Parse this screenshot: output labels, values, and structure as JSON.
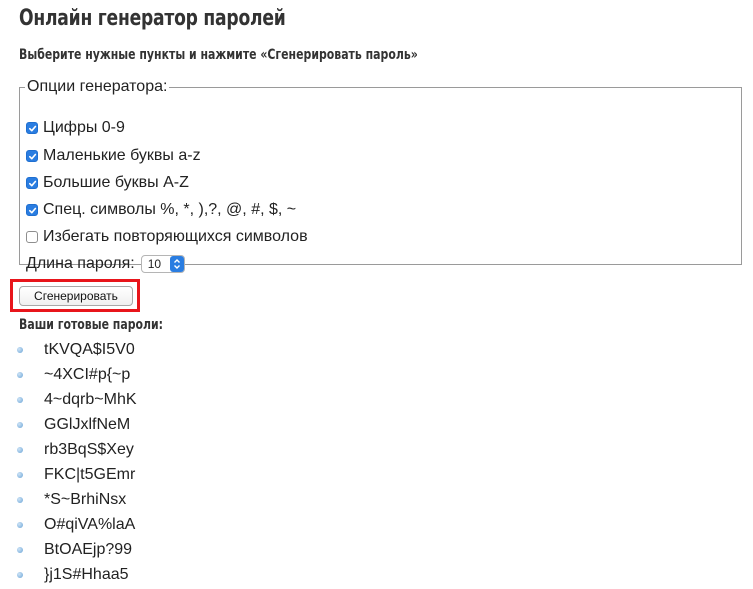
{
  "page": {
    "title": "Онлайн генератор паролей",
    "instruction": "Выберите нужные пункты и нажмите «Сгенерировать пароль»"
  },
  "options": {
    "legend": "Опции генератора:",
    "items": [
      {
        "label": "Цифры 0-9",
        "checked": true
      },
      {
        "label": "Маленькие буквы a-z",
        "checked": true
      },
      {
        "label": "Большие буквы A-Z",
        "checked": true
      },
      {
        "label": "Спец. символы %, *, ),?, @, #, $, ~",
        "checked": true
      },
      {
        "label": "Избегать повторяющихся символов",
        "checked": false
      }
    ],
    "length_label": "Длина пароля:",
    "length_value": "10"
  },
  "generate_button": {
    "label": "Сгенерировать"
  },
  "results": {
    "title": "Ваши готовые пароли:",
    "passwords": [
      "tKVQA$I5V0",
      "~4XCI#p{~p",
      "4~dqrb~MhK",
      "GGlJxlfNeM",
      "rb3BqS$Xey",
      "FKC|t5GEmr",
      "*S~BrhiNsx",
      "O#qiVA%laA",
      "BtOAEjp?99",
      "}j1S#Hhaa5"
    ]
  },
  "colors": {
    "checkbox_accent": "#2a7de1",
    "highlight_border": "#e8151b",
    "bullet": "#6aa4d6"
  }
}
